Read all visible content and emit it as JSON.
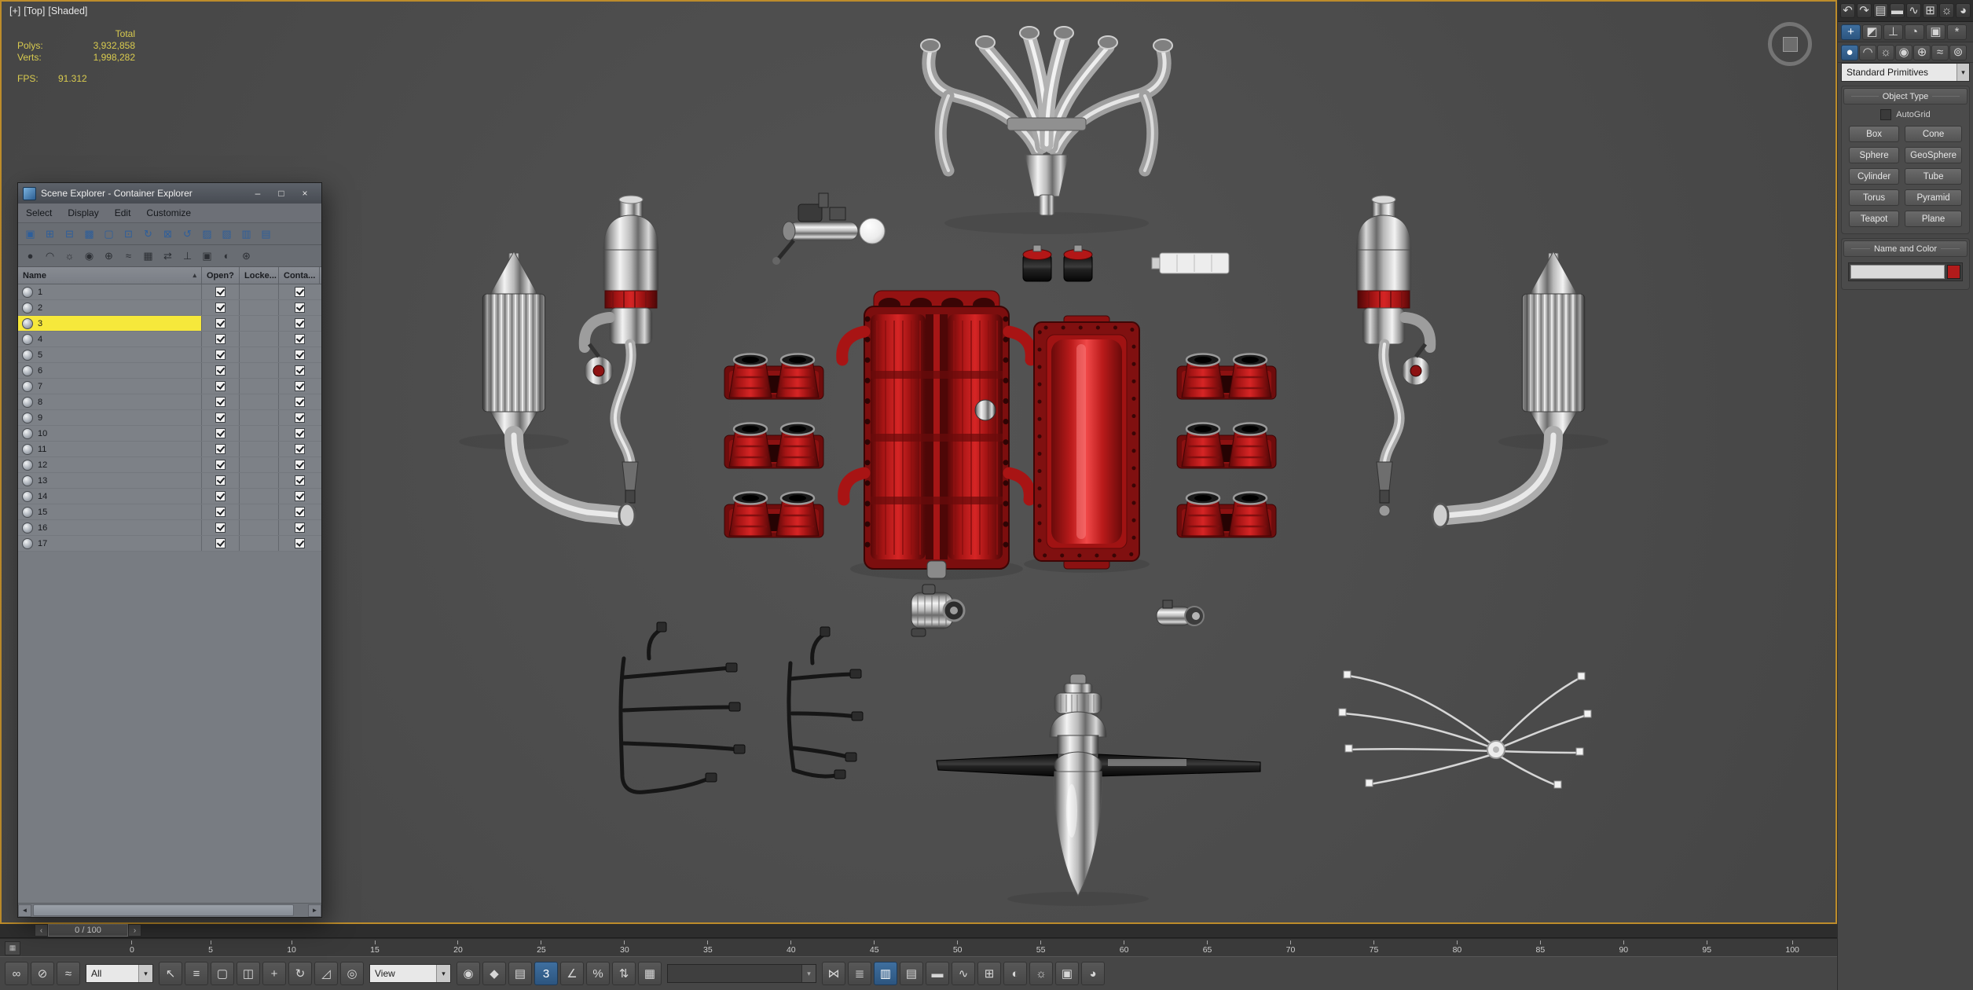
{
  "colors": {
    "active_viewport_border": "#bd8c2b",
    "viewport_bg": "#4b4b4b",
    "engine_red": "#c41818",
    "selection_yellow": "#f6e83b",
    "toolbar_highlight_blue": "#3a6ea5"
  },
  "viewport": {
    "label_plus": "[+]",
    "label_view": "[Top]",
    "label_shading": "[Shaded]",
    "stats": {
      "total_label": "Total",
      "polys_label": "Polys:",
      "polys_value": "3,932,858",
      "verts_label": "Verts:",
      "verts_value": "1,998,282",
      "fps_label": "FPS:",
      "fps_value": "91.312"
    }
  },
  "scene_explorer": {
    "title": "Scene Explorer - Container Explorer",
    "window_buttons": {
      "minimize": "–",
      "maximize": "□",
      "close": "×"
    },
    "menu": [
      {
        "name": "menu-select",
        "label": "Select"
      },
      {
        "name": "menu-display",
        "label": "Display"
      },
      {
        "name": "menu-edit",
        "label": "Edit"
      },
      {
        "name": "menu-customize",
        "label": "Customize"
      }
    ],
    "toolbar1": [
      {
        "name": "new-container-icon",
        "glyph": "▣"
      },
      {
        "name": "inherit-container-icon",
        "glyph": "⊞"
      },
      {
        "name": "merge-container-icon",
        "glyph": "⊟"
      },
      {
        "name": "close-container-icon",
        "glyph": "▩"
      },
      {
        "name": "open-container-icon",
        "glyph": "▢"
      },
      {
        "name": "save-container-icon",
        "glyph": "⊡"
      },
      {
        "name": "reload-container-icon",
        "glyph": "↻"
      },
      {
        "name": "unload-container-icon",
        "glyph": "⊠"
      },
      {
        "name": "update-container-icon",
        "glyph": "↺"
      },
      {
        "name": "make-unique-icon",
        "glyph": "▨"
      },
      {
        "name": "edit-container-icon",
        "glyph": "▧"
      },
      {
        "name": "override-properties-icon",
        "glyph": "▥"
      },
      {
        "name": "container-rules-icon",
        "glyph": "▤"
      }
    ],
    "toolbar2": [
      {
        "name": "filter-geometry-icon",
        "glyph": "●"
      },
      {
        "name": "filter-shapes-icon",
        "glyph": "◠"
      },
      {
        "name": "filter-lights-icon",
        "glyph": "☼"
      },
      {
        "name": "filter-cameras-icon",
        "glyph": "◉"
      },
      {
        "name": "filter-helpers-icon",
        "glyph": "⊕"
      },
      {
        "name": "filter-spacewarps-icon",
        "glyph": "≈"
      },
      {
        "name": "filter-groups-icon",
        "glyph": "▦"
      },
      {
        "name": "filter-xrefs-icon",
        "glyph": "⇄"
      },
      {
        "name": "filter-bones-icon",
        "glyph": "⊥"
      },
      {
        "name": "filter-containers-icon",
        "glyph": "▣"
      },
      {
        "name": "filter-materials-icon",
        "glyph": "◐"
      },
      {
        "name": "filter-frozen-icon",
        "glyph": "⊛"
      }
    ],
    "columns": {
      "name": "Name",
      "sort_indicator": "▴",
      "open": "Open?",
      "locked": "Locke...",
      "contained": "Conta..."
    },
    "rows": [
      {
        "label": "1",
        "open": true,
        "contained": true,
        "selected": false
      },
      {
        "label": "2",
        "open": true,
        "contained": true,
        "selected": false
      },
      {
        "label": "3",
        "open": true,
        "contained": true,
        "selected": true
      },
      {
        "label": "4",
        "open": true,
        "contained": true,
        "selected": false
      },
      {
        "label": "5",
        "open": true,
        "contained": true,
        "selected": false
      },
      {
        "label": "6",
        "open": true,
        "contained": true,
        "selected": false
      },
      {
        "label": "7",
        "open": true,
        "contained": true,
        "selected": false
      },
      {
        "label": "8",
        "open": true,
        "contained": true,
        "selected": false
      },
      {
        "label": "9",
        "open": true,
        "contained": true,
        "selected": false
      },
      {
        "label": "10",
        "open": true,
        "contained": true,
        "selected": false
      },
      {
        "label": "11",
        "open": true,
        "contained": true,
        "selected": false
      },
      {
        "label": "12",
        "open": true,
        "contained": true,
        "selected": false
      },
      {
        "label": "13",
        "open": true,
        "contained": true,
        "selected": false
      },
      {
        "label": "14",
        "open": true,
        "contained": true,
        "selected": false
      },
      {
        "label": "15",
        "open": true,
        "contained": true,
        "selected": false
      },
      {
        "label": "16",
        "open": true,
        "contained": true,
        "selected": false
      },
      {
        "label": "17",
        "open": true,
        "contained": true,
        "selected": false
      }
    ],
    "scrollbar": {
      "left_arrow": "◄",
      "right_arrow": "►"
    }
  },
  "command_panel": {
    "top_toolbar": [
      {
        "name": "undo-icon",
        "glyph": "↶"
      },
      {
        "name": "redo-icon",
        "glyph": "↷"
      },
      {
        "name": "layer-manager-icon",
        "glyph": "▤"
      },
      {
        "name": "graphite-ribbon-icon",
        "glyph": "▬"
      },
      {
        "name": "curve-editor-icon",
        "glyph": "∿"
      },
      {
        "name": "schematic-view-icon",
        "glyph": "⊞"
      },
      {
        "name": "render-setup-icon",
        "glyph": "☼"
      },
      {
        "name": "render-production-icon",
        "glyph": "◕"
      }
    ],
    "tabs": [
      {
        "name": "create-tab",
        "glyph": "+",
        "active": true
      },
      {
        "name": "modify-tab",
        "glyph": "◩"
      },
      {
        "name": "hierarchy-tab",
        "glyph": "⊥"
      },
      {
        "name": "motion-tab",
        "glyph": "◔"
      },
      {
        "name": "display-tab",
        "glyph": "▣"
      },
      {
        "name": "utilities-tab",
        "glyph": "*"
      }
    ],
    "categories": [
      {
        "name": "geometry-category",
        "glyph": "●",
        "active": true
      },
      {
        "name": "shapes-category",
        "glyph": "◠"
      },
      {
        "name": "lights-category",
        "glyph": "☼"
      },
      {
        "name": "cameras-category",
        "glyph": "◉"
      },
      {
        "name": "helpers-category",
        "glyph": "⊕"
      },
      {
        "name": "spacewarps-category",
        "glyph": "≈"
      },
      {
        "name": "systems-category",
        "glyph": "⊚"
      }
    ],
    "primitives_dropdown": "Standard Primitives",
    "object_type": {
      "title": "Object Type",
      "autogrid_label": "AutoGrid",
      "buttons": [
        {
          "name": "box-button",
          "label": "Box"
        },
        {
          "name": "cone-button",
          "label": "Cone"
        },
        {
          "name": "sphere-button",
          "label": "Sphere"
        },
        {
          "name": "geosphere-button",
          "label": "GeoSphere"
        },
        {
          "name": "cylinder-button",
          "label": "Cylinder"
        },
        {
          "name": "tube-button",
          "label": "Tube"
        },
        {
          "name": "torus-button",
          "label": "Torus"
        },
        {
          "name": "pyramid-button",
          "label": "Pyramid"
        },
        {
          "name": "teapot-button",
          "label": "Teapot"
        },
        {
          "name": "plane-button",
          "label": "Plane"
        }
      ]
    },
    "name_color": {
      "title": "Name and Color",
      "swatch_color": "#b21b1b"
    }
  },
  "timeline": {
    "frame_display": "0 / 100",
    "prev_arrow": "‹",
    "next_arrow": "›",
    "ticks": [
      "0",
      "5",
      "10",
      "15",
      "20",
      "25",
      "30",
      "35",
      "40",
      "45",
      "50",
      "55",
      "60",
      "65",
      "70",
      "75",
      "80",
      "85",
      "90",
      "95",
      "100"
    ]
  },
  "main_toolbar": {
    "group_link": [
      {
        "name": "select-and-link-icon",
        "glyph": "∞"
      },
      {
        "name": "unlink-selection-icon",
        "glyph": "⊘"
      },
      {
        "name": "bind-to-spacewarp-icon",
        "glyph": "≈"
      }
    ],
    "selection_filter_value": "All",
    "group_select": [
      {
        "name": "select-object-icon",
        "glyph": "↖"
      },
      {
        "name": "select-by-name-icon",
        "glyph": "≡"
      },
      {
        "name": "rectangular-selection-icon",
        "glyph": "▢"
      },
      {
        "name": "window-crossing-icon",
        "glyph": "◫"
      },
      {
        "name": "select-and-move-icon",
        "glyph": "+"
      },
      {
        "name": "select-and-rotate-icon",
        "glyph": "↻"
      },
      {
        "name": "select-and-scale-icon",
        "glyph": "◿"
      },
      {
        "name": "select-and-place-icon",
        "glyph": "◎"
      }
    ],
    "coord_system_value": "View",
    "group_snap": [
      {
        "name": "use-pivot-center-icon",
        "glyph": "◉"
      },
      {
        "name": "select-and-manipulate-icon",
        "glyph": "◆"
      },
      {
        "name": "keyboard-override-icon",
        "glyph": "▤"
      },
      {
        "name": "snap-toggle-icon",
        "glyph": "3",
        "active": true
      },
      {
        "name": "angle-snap-icon",
        "glyph": "∠"
      },
      {
        "name": "percent-snap-icon",
        "glyph": "%"
      },
      {
        "name": "spinner-snap-icon",
        "glyph": "⇅"
      }
    ],
    "group_sets": [
      {
        "name": "edit-named-sets-icon",
        "glyph": "▦"
      }
    ],
    "named_sets_value": "",
    "group_tools": [
      {
        "name": "mirror-icon",
        "glyph": "⋈"
      },
      {
        "name": "align-icon",
        "glyph": "≣"
      },
      {
        "name": "scene-explorer-toggle-icon",
        "glyph": "▥",
        "active": true
      },
      {
        "name": "layer-explorer-icon",
        "glyph": "▤"
      },
      {
        "name": "ribbon-toggle-icon",
        "glyph": "▬"
      },
      {
        "name": "curve-editor-icon",
        "glyph": "∿"
      },
      {
        "name": "schematic-view-icon",
        "glyph": "⊞"
      },
      {
        "name": "material-editor-icon",
        "glyph": "◐"
      },
      {
        "name": "render-setup-icon",
        "glyph": "☼"
      },
      {
        "name": "rendered-frame-icon",
        "glyph": "▣"
      },
      {
        "name": "render-production-icon",
        "glyph": "◕"
      }
    ]
  }
}
